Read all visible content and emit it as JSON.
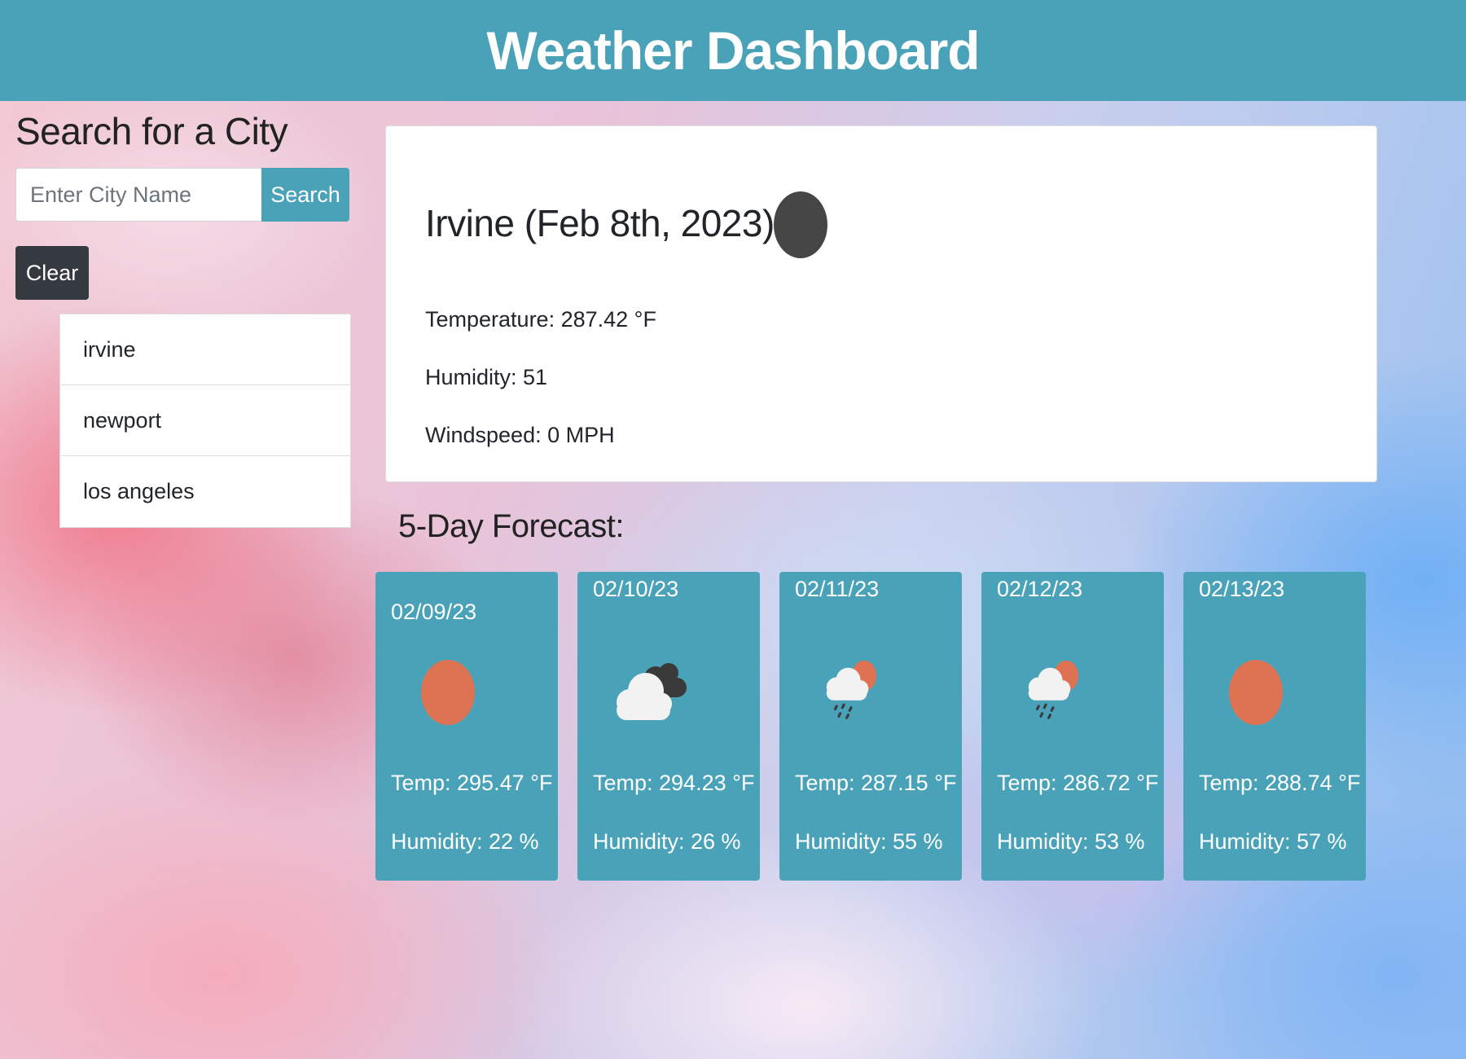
{
  "header": {
    "title": "Weather Dashboard"
  },
  "sidebar": {
    "title": "Search for a City",
    "search_placeholder": "Enter City Name",
    "search_label": "Search",
    "clear_label": "Clear",
    "history": [
      "irvine",
      "newport",
      "los angeles"
    ]
  },
  "current": {
    "title": "Irvine (Feb 8th, 2023)",
    "icon": "dark-circle-icon",
    "temperature": "Temperature: 287.42 °F",
    "humidity": "Humidity: 51",
    "windspeed": "Windspeed: 0 MPH"
  },
  "forecast": {
    "title": "5-Day Forecast:",
    "days": [
      {
        "date": "02/09/23",
        "icon": "sun-icon",
        "temp": "Temp: 295.47 °F",
        "humidity": "Humidity: 22 %"
      },
      {
        "date": "02/10/23",
        "icon": "cloudy-icon",
        "temp": "Temp: 294.23 °F",
        "humidity": "Humidity: 26 %"
      },
      {
        "date": "02/11/23",
        "icon": "rain-sun-icon",
        "temp": "Temp: 287.15 °F",
        "humidity": "Humidity: 55 %"
      },
      {
        "date": "02/12/23",
        "icon": "rain-sun-icon",
        "temp": "Temp: 286.72 °F",
        "humidity": "Humidity: 53 %"
      },
      {
        "date": "02/13/23",
        "icon": "sun-icon",
        "temp": "Temp: 288.74 °F",
        "humidity": "Humidity: 57 %"
      }
    ]
  },
  "colors": {
    "accent": "#4aa2b8",
    "dark_button": "#343a40",
    "sun": "#dd7353",
    "current_icon": "#464646"
  }
}
